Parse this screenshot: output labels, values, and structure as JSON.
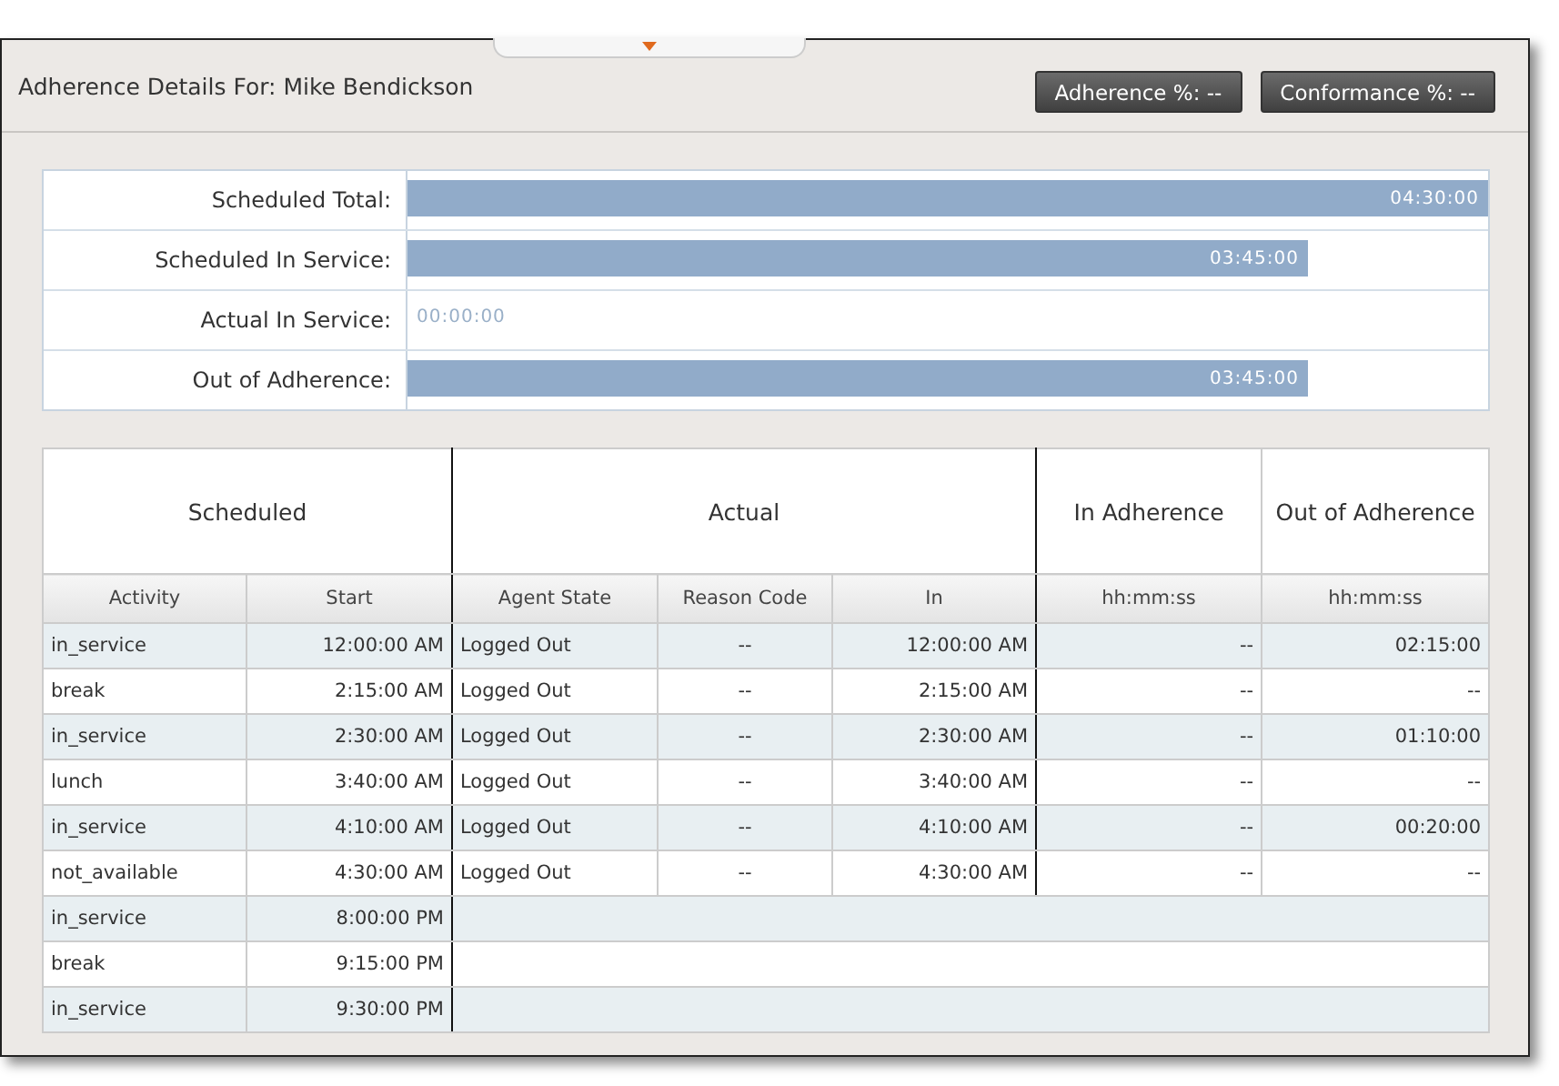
{
  "header": {
    "title": "Adherence Details For: Mike Bendickson",
    "buttons": [
      "Adherence %: --",
      "Conformance %: --"
    ]
  },
  "summary": [
    {
      "label": "Scheduled Total:",
      "level": 1,
      "reading": "04:30:00"
    },
    {
      "label": "Scheduled In Service:",
      "level": 0.8333,
      "reading": "03:45:00"
    },
    {
      "label": "Actual In Service:",
      "level": 0,
      "reading": "00:00:00"
    },
    {
      "label": "Out of Adherence:",
      "level": 0.8333,
      "reading": "03:45:00"
    }
  ],
  "table": {
    "groups": [
      "Scheduled",
      "Actual",
      "In Adherence",
      "Out of Adherence"
    ],
    "columns": [
      "Activity",
      "Start",
      "Agent State",
      "Reason Code",
      "In",
      "hh:mm:ss",
      "hh:mm:ss"
    ],
    "rows": [
      [
        "in_service",
        "12:00:00 AM",
        "Logged Out",
        "--",
        "12:00:00 AM",
        "--",
        "02:15:00"
      ],
      [
        "break",
        "2:15:00 AM",
        "Logged Out",
        "--",
        "2:15:00 AM",
        "--",
        "--"
      ],
      [
        "in_service",
        "2:30:00 AM",
        "Logged Out",
        "--",
        "2:30:00 AM",
        "--",
        "01:10:00"
      ],
      [
        "lunch",
        "3:40:00 AM",
        "Logged Out",
        "--",
        "3:40:00 AM",
        "--",
        "--"
      ],
      [
        "in_service",
        "4:10:00 AM",
        "Logged Out",
        "--",
        "4:10:00 AM",
        "--",
        "00:20:00"
      ],
      [
        "not_available",
        "4:30:00 AM",
        "Logged Out",
        "--",
        "4:30:00 AM",
        "--",
        "--"
      ],
      [
        "in_service",
        "8:00:00 PM"
      ],
      [
        "break",
        "9:15:00 PM"
      ],
      [
        "in_service",
        "9:30:00 PM"
      ]
    ]
  }
}
